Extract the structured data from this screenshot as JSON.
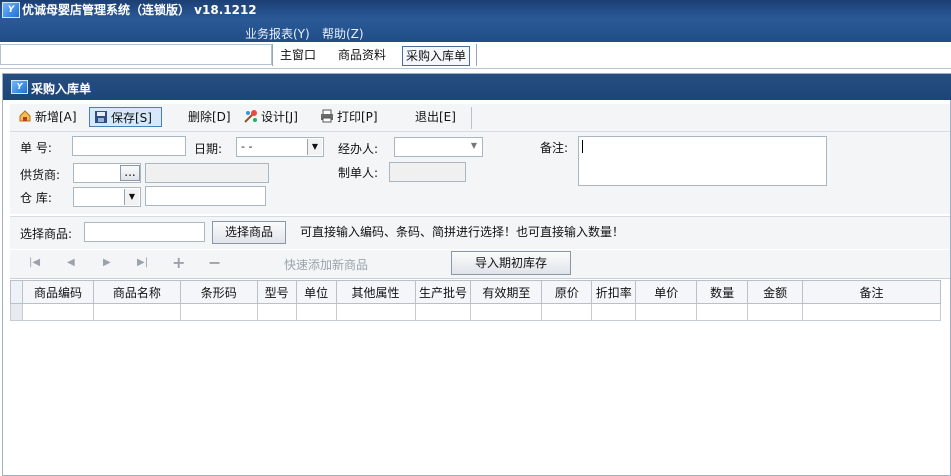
{
  "app": {
    "title": "优诚母婴店管理系统（连锁版）  v18.1212",
    "icon": "app-logo-icon"
  },
  "menu": [
    {
      "label": "业务报表(Y)"
    },
    {
      "label": "帮助(Z)"
    }
  ],
  "nav_tabs": [
    {
      "label": "主窗口"
    },
    {
      "label": "商品资料"
    },
    {
      "label": "采购入库单",
      "active": true
    }
  ],
  "window": {
    "title": "采购入库单"
  },
  "toolbar": [
    {
      "label": "新增[A]",
      "icon": "new-icon"
    },
    {
      "label": "保存[S]",
      "icon": "save-icon"
    },
    {
      "label": "删除[D]"
    },
    {
      "label": "设计[J]",
      "icon": "design-icon"
    },
    {
      "label": "打印[P]",
      "icon": "print-icon"
    },
    {
      "label": "退出[E]"
    }
  ],
  "form": {
    "doc_no_label": "单  号:",
    "date_label": "日期:",
    "date_value": " - -",
    "handler_label": "经办人:",
    "remark_label": "备注:",
    "supplier_label": "供货商:",
    "supplier_btn": "...",
    "maker_label": "制单人:",
    "warehouse_label": "仓  库:"
  },
  "select_row": {
    "label": "选择商品:",
    "button": "选择商品",
    "hint": "可直接输入编码、条码、简拼进行选择！也可直接输入数量！"
  },
  "nav_row": {
    "quick_add": "快速添加新商品",
    "import_button": "导入期初库存"
  },
  "grid": {
    "columns": [
      "商品编码",
      "商品名称",
      "条形码",
      "型号",
      "单位",
      "其他属性",
      "生产批号",
      "有效期至",
      "原价",
      "折扣率",
      "单价",
      "数量",
      "金额",
      "备注"
    ]
  },
  "colors": {
    "title_bar": "#1f4d87",
    "window_title": "#234a7c",
    "toolbar_bg": "#f3f5f7"
  }
}
